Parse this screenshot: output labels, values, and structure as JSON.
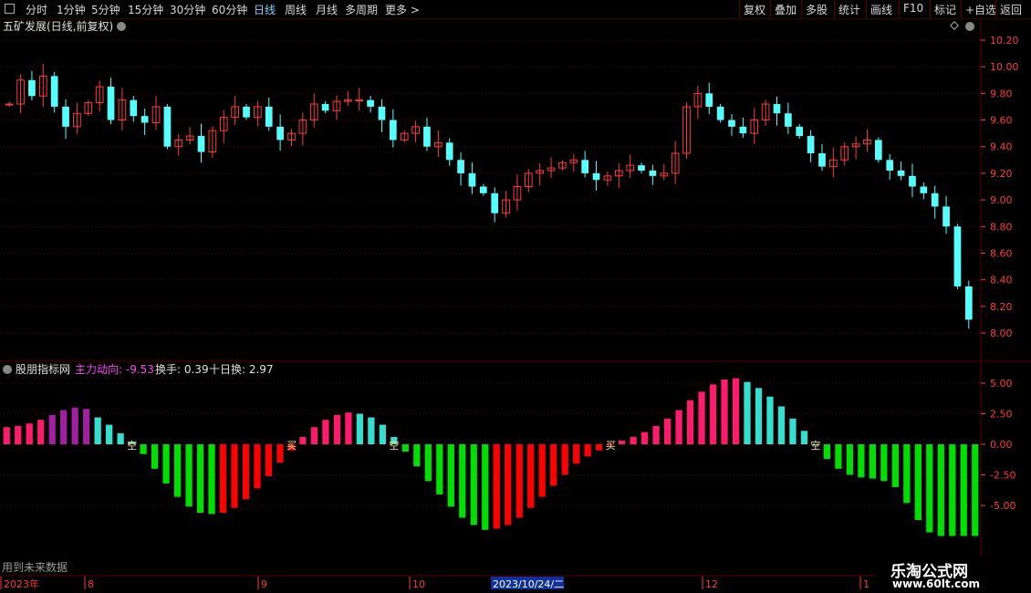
{
  "toolbar": {
    "left": [
      "分时",
      "1分钟",
      "5分钟",
      "15分钟",
      "30分钟",
      "60分钟",
      "日线",
      "周线",
      "月线",
      "多周期",
      "更多 >"
    ],
    "active": "日线",
    "right": [
      "复权",
      "叠加",
      "多股",
      "统计",
      "画线",
      "F10",
      "标记",
      "+自选",
      "返回"
    ]
  },
  "main": {
    "title": "五矿发展(日线,前复权)",
    "y_labels": [
      "10.20",
      "10.00",
      "9.80",
      "9.60",
      "9.40",
      "9.20",
      "9.00",
      "8.80",
      "8.60",
      "8.40",
      "8.20",
      "8.00"
    ]
  },
  "indicator": {
    "name": "股朋指标网",
    "main_label": "主力动向: -9.53",
    "turnover_label": "换手: 0.39",
    "ten_day_label": "十日换: 2.97",
    "y_labels": [
      "5.00",
      "2.50",
      "0.00",
      "-2.50",
      "-5.00"
    ],
    "signals": [
      {
        "text": "空",
        "i": 11
      },
      {
        "text": "买",
        "i": 25
      },
      {
        "text": "空",
        "i": 34
      },
      {
        "text": "买",
        "i": 53
      },
      {
        "text": "空",
        "i": 71
      }
    ]
  },
  "footer": {
    "note": "用到未来数据",
    "time_labels": [
      "2023年",
      "8",
      "9",
      "10",
      "2023/10/24/二",
      "12",
      "1"
    ]
  },
  "watermark": {
    "line1": "乐淘公式网",
    "line2": "www.60lt.com"
  },
  "colors": {
    "up": "#ff3c3c",
    "down": "#54ffff",
    "green": "#00e000",
    "red": "#ff0000",
    "pink": "#ff1a6e",
    "cyan": "#33e0d0",
    "purple": "#a020a0",
    "magenta": "#ff40ff",
    "grid": "#5a0000"
  },
  "chart_data": [
    {
      "type": "candlestick",
      "title": "五矿发展(日线,前复权)",
      "ylim": [
        7.9,
        10.3
      ],
      "close": [
        9.72,
        9.9,
        9.78,
        9.93,
        9.7,
        9.55,
        9.65,
        9.73,
        9.85,
        9.6,
        9.75,
        9.63,
        9.58,
        9.7,
        9.4,
        9.45,
        9.48,
        9.36,
        9.52,
        9.62,
        9.7,
        9.62,
        9.7,
        9.55,
        9.45,
        9.5,
        9.6,
        9.72,
        9.67,
        9.74,
        9.75,
        9.75,
        9.7,
        9.6,
        9.45,
        9.5,
        9.55,
        9.4,
        9.43,
        9.3,
        9.2,
        9.1,
        9.05,
        8.9,
        9.0,
        9.1,
        9.2,
        9.22,
        9.24,
        9.28,
        9.3,
        9.2,
        9.15,
        9.18,
        9.22,
        9.26,
        9.22,
        9.18,
        9.2,
        9.35,
        9.7,
        9.8,
        9.7,
        9.6,
        9.55,
        9.5,
        9.6,
        9.72,
        9.65,
        9.55,
        9.48,
        9.35,
        9.25,
        9.3,
        9.4,
        9.42,
        9.45,
        9.3,
        9.22,
        9.18,
        9.1,
        9.05,
        8.95,
        8.8,
        8.35,
        8.1
      ],
      "change": [
        0,
        0.18,
        -0.12,
        0.15,
        -0.23,
        -0.15,
        0.1,
        0.08,
        0.12,
        -0.25,
        0.15,
        -0.12,
        -0.05,
        0.12,
        -0.3,
        0.05,
        0.03,
        -0.12,
        0.16,
        0.1,
        0.08,
        -0.08,
        0.08,
        -0.15,
        -0.1,
        0.05,
        0.1,
        0.12,
        -0.05,
        0.07,
        0.01,
        0,
        -0.05,
        -0.1,
        -0.15,
        0.05,
        0.05,
        -0.15,
        0.03,
        -0.13,
        -0.1,
        -0.1,
        -0.05,
        -0.15,
        0.1,
        0.1,
        0.1,
        0.02,
        0.02,
        0.04,
        0.02,
        -0.1,
        -0.05,
        0.03,
        0.04,
        0.04,
        -0.04,
        -0.04,
        0.02,
        0.15,
        0.35,
        0.1,
        -0.1,
        -0.1,
        -0.05,
        -0.05,
        0.1,
        0.12,
        -0.07,
        -0.1,
        -0.07,
        -0.13,
        -0.1,
        0.05,
        0.1,
        0.02,
        0.03,
        -0.15,
        -0.08,
        -0.04,
        -0.08,
        -0.05,
        -0.1,
        -0.15,
        -0.45,
        -0.25
      ]
    },
    {
      "type": "bar",
      "title": "股朋指标网",
      "ylim": [
        -7.5,
        5.5
      ],
      "values": [
        1.4,
        1.5,
        1.7,
        2.0,
        2.4,
        2.8,
        3.0,
        2.9,
        2.2,
        1.6,
        0.9,
        0.2,
        -0.8,
        -2.0,
        -3.2,
        -4.3,
        -5.1,
        -5.6,
        -5.7,
        -5.6,
        -5.2,
        -4.5,
        -3.6,
        -2.6,
        -1.5,
        -0.5,
        0.6,
        1.4,
        2.0,
        2.4,
        2.6,
        2.5,
        2.2,
        1.6,
        0.6,
        -0.6,
        -1.8,
        -3.0,
        -4.1,
        -5.1,
        -6.0,
        -6.6,
        -7.0,
        -6.9,
        -6.6,
        -6.0,
        -5.2,
        -4.3,
        -3.4,
        -2.5,
        -1.6,
        -1.0,
        -0.5,
        -0.1,
        0.3,
        0.6,
        1.0,
        1.5,
        2.1,
        2.8,
        3.6,
        4.3,
        4.9,
        5.3,
        5.4,
        5.1,
        4.6,
        3.9,
        3.1,
        2.1,
        1.1,
        0.0,
        -1.2,
        -2.0,
        -2.5,
        -2.7,
        -2.8,
        -3.0,
        -3.5,
        -4.8,
        -6.2,
        -7.2,
        -7.5,
        -7.5,
        -7.5,
        -7.5
      ],
      "categories": [
        "2023年",
        "8",
        "9",
        "10",
        "2023/10/24/二",
        "12",
        "1"
      ]
    }
  ]
}
